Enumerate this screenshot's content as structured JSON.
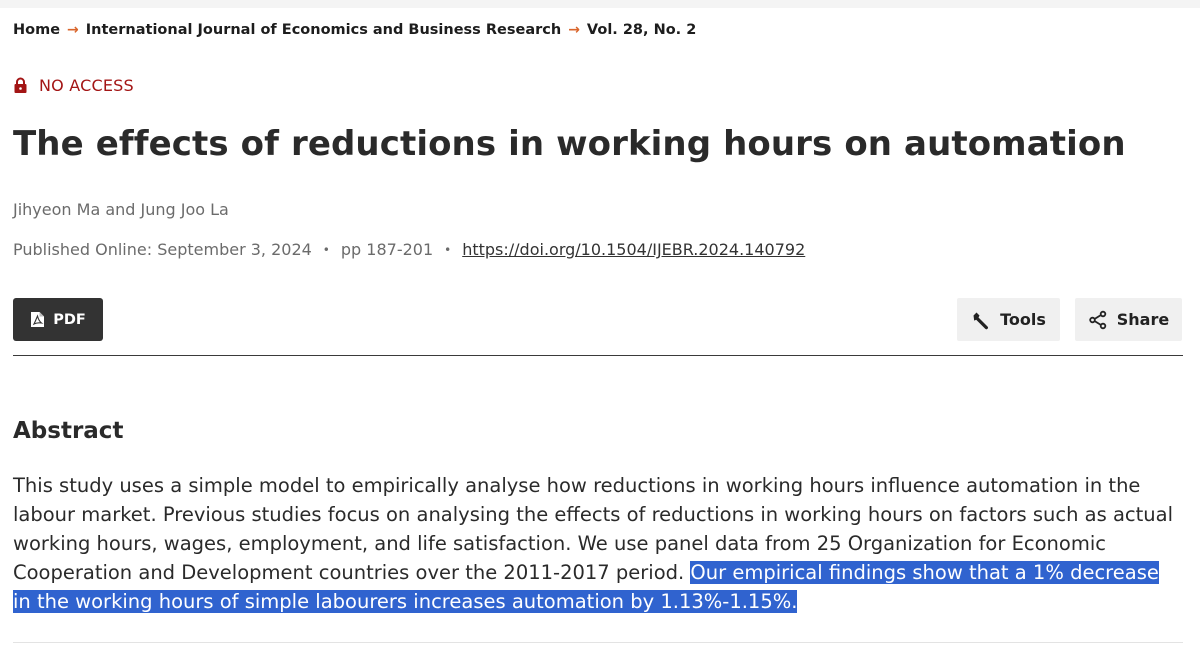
{
  "breadcrumb": {
    "home": "Home",
    "journal": "International Journal of Economics and Business Research",
    "issue": "Vol. 28, No. 2",
    "separator": "→"
  },
  "access": {
    "label": "NO ACCESS",
    "icon": "lock-icon",
    "color": "#a31515"
  },
  "article": {
    "title": "The effects of reductions in working hours on automation",
    "authors": "Jihyeon Ma and Jung Joo La",
    "published": "Published Online: September 3, 2024",
    "pages": "pp 187-201",
    "doi": "https://doi.org/10.1504/IJEBR.2024.140792",
    "bullet": "•"
  },
  "actions": {
    "pdf_label": "PDF",
    "tools_label": "Tools",
    "share_label": "Share"
  },
  "abstract": {
    "heading": "Abstract",
    "text_plain": "This study uses a simple model to empirically analyse how reductions in working hours influence automation in the labour market. Previous studies focus on analysing the effects of reductions in working hours on factors such as actual working hours, wages, employment, and life satisfaction. We use panel data from 25 Organization for Economic Cooperation and Development countries over the 2011-2017 period. ",
    "text_selected": "Our empirical findings show that a 1% decrease in the working hours of simple labourers increases automation by 1.13%-1.15%.",
    "selection_color": "#3063cf"
  },
  "colors": {
    "accent_arrow": "#d9652b",
    "pdf_button_bg": "#333333",
    "secondary_button_bg": "#f0f0f0"
  }
}
